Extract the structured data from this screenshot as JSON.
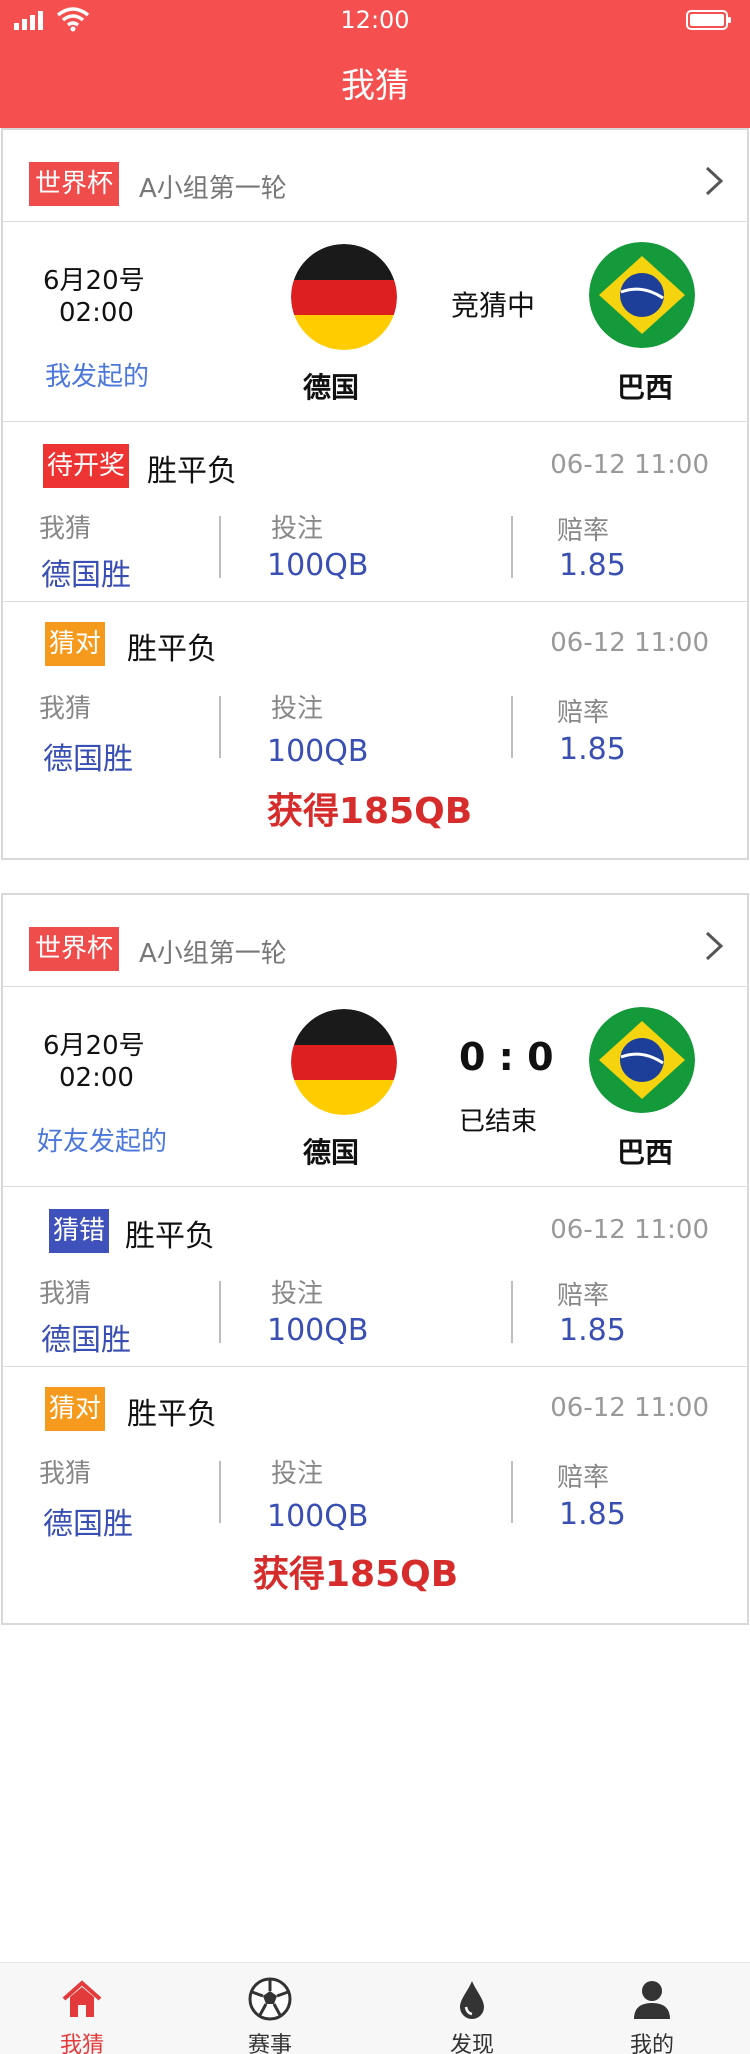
{
  "status_bar": {
    "time": "12:00"
  },
  "header": {
    "title": "我猜"
  },
  "cards": [
    {
      "tag": "世界杯",
      "round": "A小组第一轮",
      "match": {
        "date": "6月20号",
        "time": "02:00",
        "initiator": "我发起的",
        "home": "德国",
        "away": "巴西",
        "status": "竞猜中"
      },
      "bets": [
        {
          "badge": "待开奖",
          "type": "胜平负",
          "time": "06-12 11:00",
          "guess_label": "我猜",
          "guess": "德国胜",
          "stake_label": "投注",
          "stake": "100QB",
          "odds_label": "赔率",
          "odds": "1.85"
        },
        {
          "badge": "猜对",
          "type": "胜平负",
          "time": "06-12 11:00",
          "guess_label": "我猜",
          "guess": "德国胜",
          "stake_label": "投注",
          "stake": "100QB",
          "odds_label": "赔率",
          "odds": "1.85",
          "winnings": "获得185QB"
        }
      ]
    },
    {
      "tag": "世界杯",
      "round": "A小组第一轮",
      "match": {
        "date": "6月20号",
        "time": "02:00",
        "initiator": "好友发起的",
        "home": "德国",
        "away": "巴西",
        "score": "0 : 0",
        "status": "已结束"
      },
      "bets": [
        {
          "badge": "猜错",
          "type": "胜平负",
          "time": "06-12 11:00",
          "guess_label": "我猜",
          "guess": "德国胜",
          "stake_label": "投注",
          "stake": "100QB",
          "odds_label": "赔率",
          "odds": "1.85"
        },
        {
          "badge": "猜对",
          "type": "胜平负",
          "time": "06-12 11:00",
          "guess_label": "我猜",
          "guess": "德国胜",
          "stake_label": "投注",
          "stake": "100QB",
          "odds_label": "赔率",
          "odds": "1.85",
          "winnings": "获得185QB"
        }
      ]
    }
  ],
  "tabbar": {
    "items": [
      {
        "label": "我猜",
        "icon": "home-icon",
        "active": true
      },
      {
        "label": "赛事",
        "icon": "soccer-ball-icon"
      },
      {
        "label": "发现",
        "icon": "drop-icon"
      },
      {
        "label": "我的",
        "icon": "user-icon"
      }
    ]
  },
  "colors": {
    "header": "#f64f4f",
    "accent_red": "#d72c2c",
    "link_blue": "#4c78dc",
    "value_blue": "#3a4fb3",
    "badge_orange": "#f59a1c",
    "badge_indigo": "#3f52bb"
  }
}
